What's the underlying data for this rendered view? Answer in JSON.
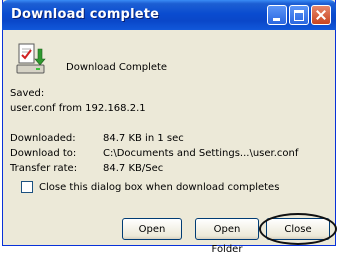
{
  "window": {
    "title": "Download complete"
  },
  "header": {
    "message": "Download Complete"
  },
  "saved": {
    "label": "Saved:",
    "value": "user.conf from 192.168.2.1"
  },
  "details": [
    {
      "label": "Downloaded:",
      "value": "84.7 KB in 1 sec"
    },
    {
      "label": "Download to:",
      "value": "C:\\Documents and Settings...\\user.conf"
    },
    {
      "label": "Transfer rate:",
      "value": "84.7 KB/Sec"
    }
  ],
  "options": {
    "close_when_done_label": "Close this dialog box when download completes",
    "close_when_done_checked": false
  },
  "buttons": {
    "open": "Open",
    "open_folder": "Open Folder",
    "close": "Close"
  },
  "icons": {
    "title_minimize": "minimize-icon",
    "title_maximize": "maximize-icon",
    "title_close": "close-icon",
    "download": "download-complete-icon"
  },
  "colors": {
    "titlebar": "#0a4cd0",
    "dialog_background": "#ece9d8",
    "title_close_button": "#c9451f"
  }
}
